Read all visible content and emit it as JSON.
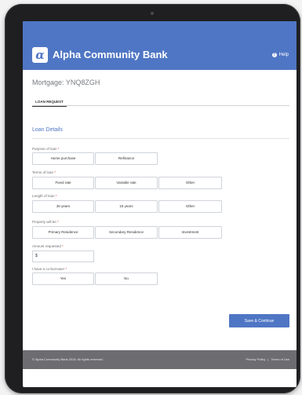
{
  "header": {
    "brand_name": "Alpha Community Bank",
    "logo_glyph": "α",
    "help_label": "Help",
    "accent_color": "#4f76c4"
  },
  "page": {
    "title": "Mortgage: YNQ8ZGH",
    "tab_label": "LOAN REQUEST"
  },
  "form": {
    "section_title": "Loan Details",
    "purpose": {
      "label": "Purpose of loan",
      "options": [
        "Home purchase",
        "Refinance"
      ]
    },
    "terms": {
      "label": "Terms of loan",
      "options": [
        "Fixed rate",
        "Variable rate",
        "Other"
      ]
    },
    "length": {
      "label": "Length of loan",
      "options": [
        "30 years",
        "15 years",
        "Other"
      ]
    },
    "property": {
      "label": "Property will be",
      "options": [
        "Primary Residence",
        "Secondary Residence",
        "Investment"
      ]
    },
    "amount": {
      "label": "Amount requested",
      "value": "$"
    },
    "coborrower": {
      "label": "I have a co-borrower",
      "options": [
        "Yes",
        "No"
      ]
    },
    "required_mark": "*",
    "save_label": "Save & Continue"
  },
  "footer": {
    "copyright": "© Alpha Community Bank 2018. All rights reserved.",
    "privacy": "Privacy Policy",
    "separator": "|",
    "terms": "Terms of Use"
  }
}
